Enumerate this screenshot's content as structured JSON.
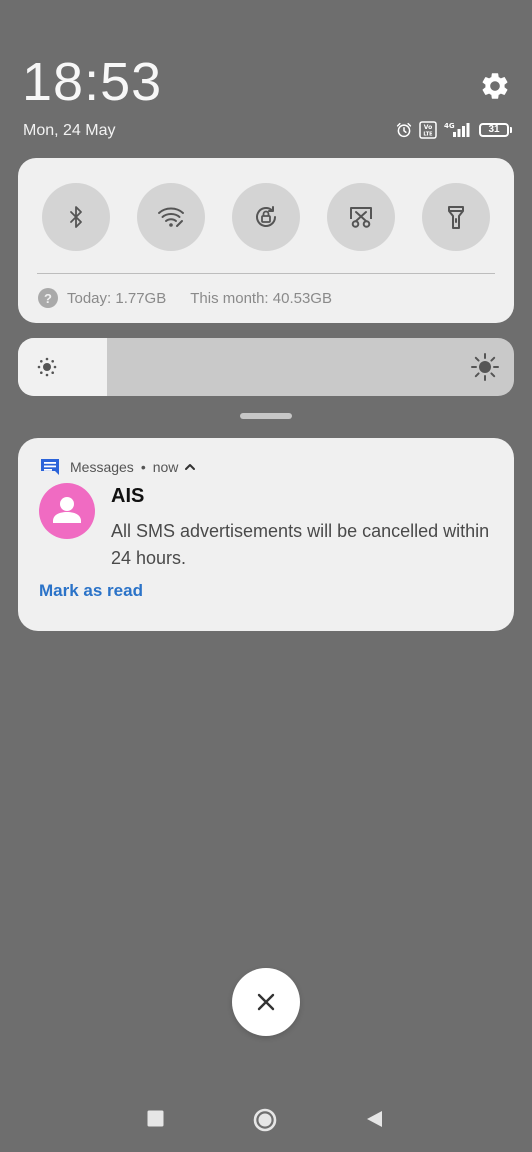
{
  "status": {
    "time": "18:53",
    "date": "Mon, 24 May",
    "battery_level": "31",
    "network": "4G",
    "volte": "Vo LTE",
    "icons": [
      "alarm-icon",
      "volte-icon",
      "signal-4g-icon",
      "battery-icon"
    ]
  },
  "quick_settings": {
    "toggles": [
      {
        "name": "bluetooth",
        "icon": "bluetooth-icon"
      },
      {
        "name": "wifi",
        "icon": "wifi-icon"
      },
      {
        "name": "auto-rotate",
        "icon": "rotation-lock-icon"
      },
      {
        "name": "screenshot",
        "icon": "screenshot-scissors-icon"
      },
      {
        "name": "flashlight",
        "icon": "flashlight-icon"
      }
    ],
    "usage_today": "Today: 1.77GB",
    "usage_month": "This month: 40.53GB"
  },
  "brightness": {
    "level": 0.18
  },
  "notification": {
    "app_name": "Messages",
    "separator": "•",
    "time": "now",
    "sender": "AIS",
    "body": "All SMS advertisements will be cancelled within 24 hours.",
    "action": "Mark as read"
  },
  "colors": {
    "background": "#6e6e6e",
    "panel": "#f0f0f0",
    "toggle_bg": "#d4d4d4",
    "avatar": "#f06bc2",
    "action": "#2b73c8",
    "app_icon": "#2b63d9"
  },
  "nav": {
    "buttons": [
      "recents-button",
      "home-button",
      "back-button"
    ]
  }
}
